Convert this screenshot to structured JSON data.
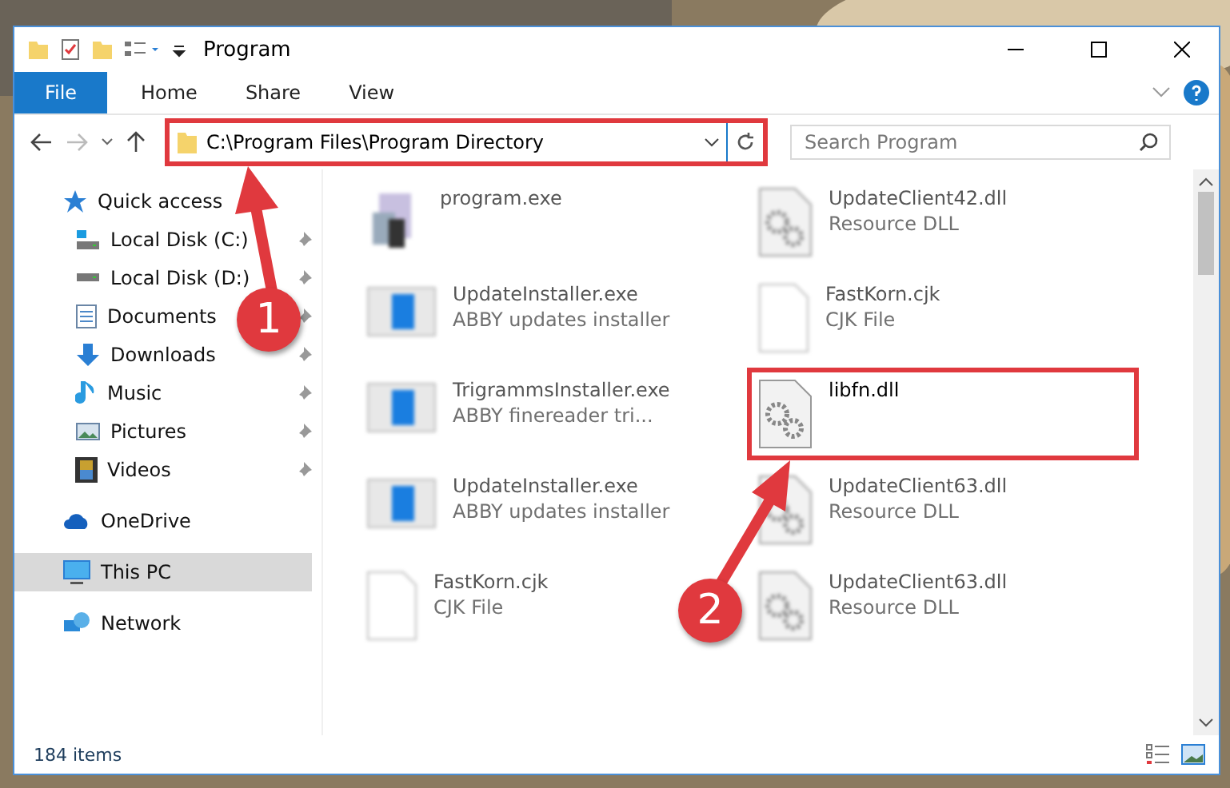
{
  "window": {
    "title": "Program"
  },
  "ribbon_tabs": [
    {
      "label": "File",
      "kind": "backstage"
    },
    {
      "label": "Home",
      "kind": "tab"
    },
    {
      "label": "Share",
      "kind": "tab"
    },
    {
      "label": "View",
      "kind": "tab"
    }
  ],
  "address": {
    "path": "C:\\Program Files\\Program Directory",
    "highlighted": true
  },
  "search": {
    "placeholder": "Search Program"
  },
  "sidebar": {
    "items": [
      {
        "label": "Quick access",
        "kind": "star",
        "selected": false,
        "children": [
          {
            "label": "Local Disk (C:)",
            "kind": "sysdrive",
            "pinned": true
          },
          {
            "label": "Local Disk (D:)",
            "kind": "drive",
            "pinned": true
          },
          {
            "label": "Documents",
            "kind": "documents",
            "pinned": true
          },
          {
            "label": "Downloads",
            "kind": "downloads",
            "pinned": true
          },
          {
            "label": "Music",
            "kind": "music",
            "pinned": true
          },
          {
            "label": "Pictures",
            "kind": "pictures",
            "pinned": true
          },
          {
            "label": "Videos",
            "kind": "videos",
            "pinned": true
          }
        ]
      },
      {
        "label": "OneDrive",
        "kind": "cloud",
        "selected": false
      },
      {
        "label": "This PC",
        "kind": "pc",
        "selected": true
      },
      {
        "label": "Network",
        "kind": "network",
        "selected": false
      }
    ]
  },
  "files": [
    {
      "name": "program.exe",
      "kind": "app",
      "blurred": true,
      "highlighted": false
    },
    {
      "name": "UpdateClient42.dll",
      "type": "Resource DLL",
      "kind": "dll",
      "blurred": true,
      "highlighted": false
    },
    {
      "name": "UpdateInstaller.exe",
      "type": "ABBY updates installer",
      "kind": "installer",
      "blurred": true,
      "highlighted": false
    },
    {
      "name": "FastKorn.cjk",
      "type": "CJK File",
      "kind": "doc",
      "blurred": true,
      "highlighted": false
    },
    {
      "name": "TrigrammsInstaller.exe",
      "type": "ABBY finereader tri...",
      "kind": "installer",
      "blurred": true,
      "highlighted": false
    },
    {
      "name": "libfn.dll",
      "kind": "dll",
      "blurred": false,
      "highlighted": true
    },
    {
      "name": "UpdateInstaller.exe",
      "type": "ABBY updates installer",
      "kind": "installer",
      "blurred": true,
      "highlighted": false
    },
    {
      "name": "UpdateClient63.dll",
      "type": "Resource DLL",
      "kind": "dll",
      "blurred": true,
      "highlighted": false
    },
    {
      "name": "FastKorn.cjk",
      "type": "CJK File",
      "kind": "doc",
      "blurred": true,
      "highlighted": false
    },
    {
      "name": "UpdateClient63.dll",
      "type": "Resource DLL",
      "kind": "dll",
      "blurred": true,
      "highlighted": false
    }
  ],
  "status_bar": {
    "count": "184 items"
  },
  "markers": [
    "1",
    "2"
  ]
}
